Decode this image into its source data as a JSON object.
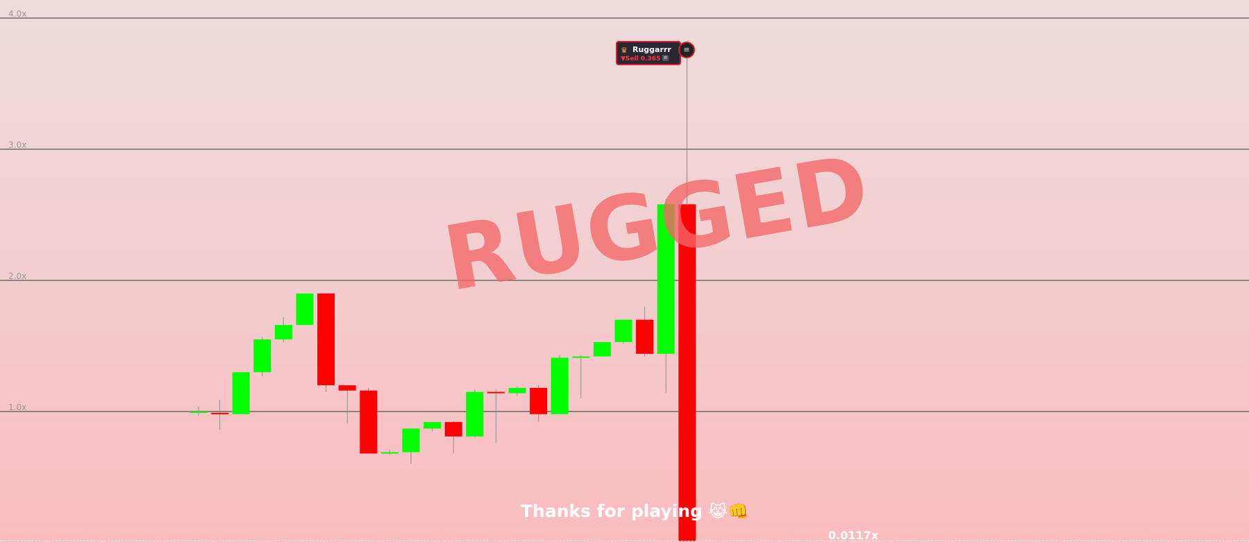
{
  "chart_data": {
    "type": "candlestick",
    "y_axis": {
      "ticks": [
        {
          "value": 1.0,
          "label": "1.0x"
        },
        {
          "value": 2.0,
          "label": "2.0x"
        },
        {
          "value": 3.0,
          "label": "3.0x"
        },
        {
          "value": 4.0,
          "label": "4.0x"
        }
      ],
      "grid": true
    },
    "candles": [
      {
        "open": 0.99,
        "close": 1.0,
        "high": 1.04,
        "low": 0.97
      },
      {
        "open": 0.99,
        "close": 0.98,
        "high": 1.09,
        "low": 0.86
      },
      {
        "open": 0.98,
        "close": 1.3,
        "high": 1.3,
        "low": 0.98
      },
      {
        "open": 1.3,
        "close": 1.55,
        "high": 1.57,
        "low": 1.27
      },
      {
        "open": 1.55,
        "close": 1.66,
        "high": 1.72,
        "low": 1.53
      },
      {
        "open": 1.66,
        "close": 1.9,
        "high": 1.9,
        "low": 1.66
      },
      {
        "open": 1.9,
        "close": 1.2,
        "high": 1.9,
        "low": 1.15
      },
      {
        "open": 1.2,
        "close": 1.16,
        "high": 1.2,
        "low": 0.91
      },
      {
        "open": 1.16,
        "close": 0.68,
        "high": 1.18,
        "low": 0.68
      },
      {
        "open": 0.68,
        "close": 0.69,
        "high": 0.71,
        "low": 0.67
      },
      {
        "open": 0.69,
        "close": 0.87,
        "high": 0.87,
        "low": 0.6
      },
      {
        "open": 0.87,
        "close": 0.92,
        "high": 0.92,
        "low": 0.85
      },
      {
        "open": 0.92,
        "close": 0.81,
        "high": 0.93,
        "low": 0.68
      },
      {
        "open": 0.81,
        "close": 1.15,
        "high": 1.17,
        "low": 0.8
      },
      {
        "open": 1.15,
        "close": 1.14,
        "high": 1.17,
        "low": 0.76
      },
      {
        "open": 1.14,
        "close": 1.18,
        "high": 1.19,
        "low": 1.12
      },
      {
        "open": 1.18,
        "close": 0.98,
        "high": 1.2,
        "low": 0.92
      },
      {
        "open": 0.98,
        "close": 1.41,
        "high": 1.43,
        "low": 0.98
      },
      {
        "open": 1.41,
        "close": 1.42,
        "high": 1.43,
        "low": 1.1
      },
      {
        "open": 1.42,
        "close": 1.53,
        "high": 1.53,
        "low": 1.42
      },
      {
        "open": 1.53,
        "close": 1.7,
        "high": 1.7,
        "low": 1.52
      },
      {
        "open": 1.7,
        "close": 1.44,
        "high": 1.8,
        "low": 1.42
      },
      {
        "open": 1.44,
        "close": 2.58,
        "high": 2.62,
        "low": 1.14
      },
      {
        "open": 2.58,
        "close": 0.0117,
        "high": 2.58,
        "low": 0.0117
      }
    ],
    "colors": {
      "up": "#00ff00",
      "down": "#ff0000",
      "grid": "#555555"
    }
  },
  "overlay": {
    "rugged_text": "RUGGED",
    "thanks_text": "Thanks for playing",
    "thanks_emoji": "😹👊",
    "final_multiplier": "0.0117x"
  },
  "trade_tooltip": {
    "username": "Ruggarrr",
    "crown_icon": "crown-icon",
    "trade_text": "▼Sell 0.365"
  }
}
